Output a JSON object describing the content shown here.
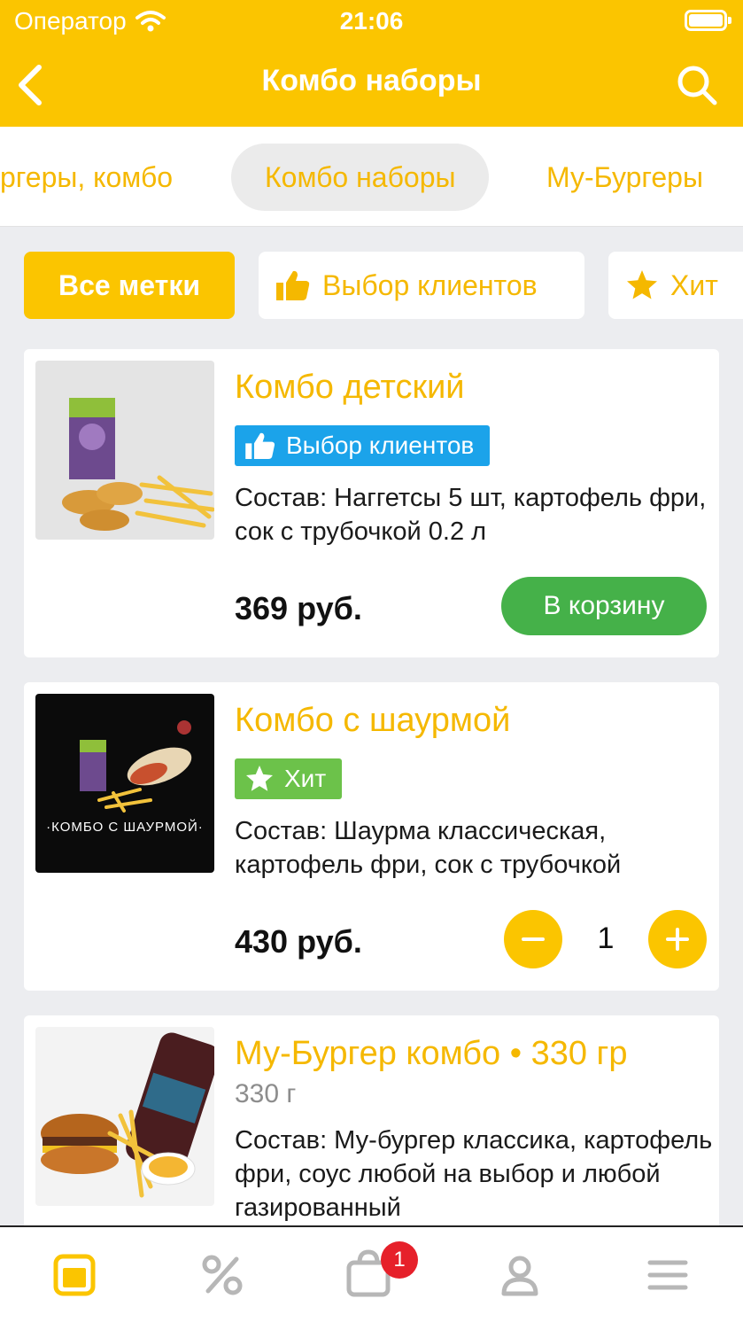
{
  "status_bar": {
    "carrier": "Оператор",
    "time": "21:06"
  },
  "nav": {
    "title": "Комбо наборы",
    "back_icon": "chevron-left-icon",
    "search_icon": "search-icon"
  },
  "categories": [
    "ргеры, комбо",
    "Комбо наборы",
    "Му-Бургеры"
  ],
  "tags": [
    "Все метки",
    "Выбор клиентов",
    "Хит"
  ],
  "products": [
    {
      "name": "Комбо детский",
      "badge": "Выбор клиентов",
      "description": "Состав: Наггетсы 5 шт, картофель фри, сок с трубочкой 0.2 л",
      "price": "369 руб.",
      "action": "В корзину"
    },
    {
      "name": "Комбо с шаурмой",
      "badge": "Хит",
      "image_caption": "·КОМБО С ШАУРМОЙ·",
      "description": "Состав: Шаурма классическая, картофель фри, сок с трубочкой",
      "price": "430 руб.",
      "quantity": "1"
    },
    {
      "name": "Му-Бургер комбо • 330 гр",
      "weight": "330 г",
      "description": "Состав: Му-бургер классика, картофель фри, соус любой на выбор и любой газированный"
    }
  ],
  "tabbar": {
    "items": [
      "menu-icon",
      "discount-icon",
      "cart-icon",
      "profile-icon",
      "more-icon"
    ],
    "cart_count": "1"
  },
  "colors": {
    "accent": "#fbc500",
    "text_accent": "#f5b800",
    "green": "#45b149",
    "blue": "#1ba3ea",
    "hit_green": "#6cc24a",
    "badge_red": "#e6202a"
  }
}
